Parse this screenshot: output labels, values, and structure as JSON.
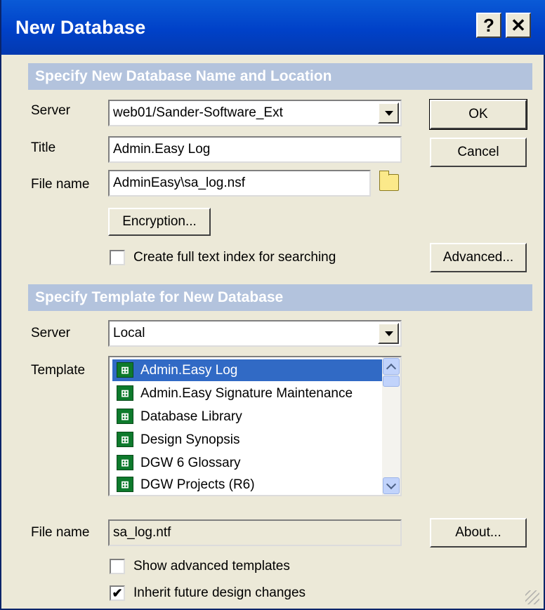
{
  "window": {
    "title": "New Database"
  },
  "titlebar": {
    "help_label": "?",
    "close_label": "✕"
  },
  "section1": {
    "header": "Specify New Database Name and Location",
    "server_label": "Server",
    "server_value": "web01/Sander-Software_Ext",
    "title_label": "Title",
    "title_value": "Admin.Easy Log",
    "filename_label": "File name",
    "filename_value": "AdminEasy\\sa_log.nsf",
    "encryption_button": "Encryption...",
    "fulltext_checkbox": {
      "label": "Create full text index for searching",
      "checked": false
    }
  },
  "buttons": {
    "ok": "OK",
    "cancel": "Cancel",
    "advanced": "Advanced...",
    "about": "About..."
  },
  "section2": {
    "header": "Specify Template for New Database",
    "server_label": "Server",
    "server_value": "Local",
    "template_label": "Template",
    "templates": [
      {
        "name": "Admin.Easy Log",
        "selected": true
      },
      {
        "name": "Admin.Easy Signature Maintenance",
        "selected": false
      },
      {
        "name": "Database Library",
        "selected": false
      },
      {
        "name": "Design Synopsis",
        "selected": false
      },
      {
        "name": "DGW 6 Glossary",
        "selected": false
      },
      {
        "name": "DGW Projects (R6)",
        "selected": false
      }
    ],
    "template_icon_glyph": "⊞",
    "filename_label": "File name",
    "filename_value": "sa_log.ntf",
    "show_advanced_checkbox": {
      "label": "Show advanced templates",
      "checked": false
    },
    "inherit_checkbox": {
      "label": "Inherit future design changes",
      "checked": true,
      "mark": "✔"
    }
  },
  "colors": {
    "titlebar": "#0041c8",
    "section_header": "#b3c3dd",
    "selection": "#316ac5",
    "dialog_bg": "#ece9d8"
  }
}
